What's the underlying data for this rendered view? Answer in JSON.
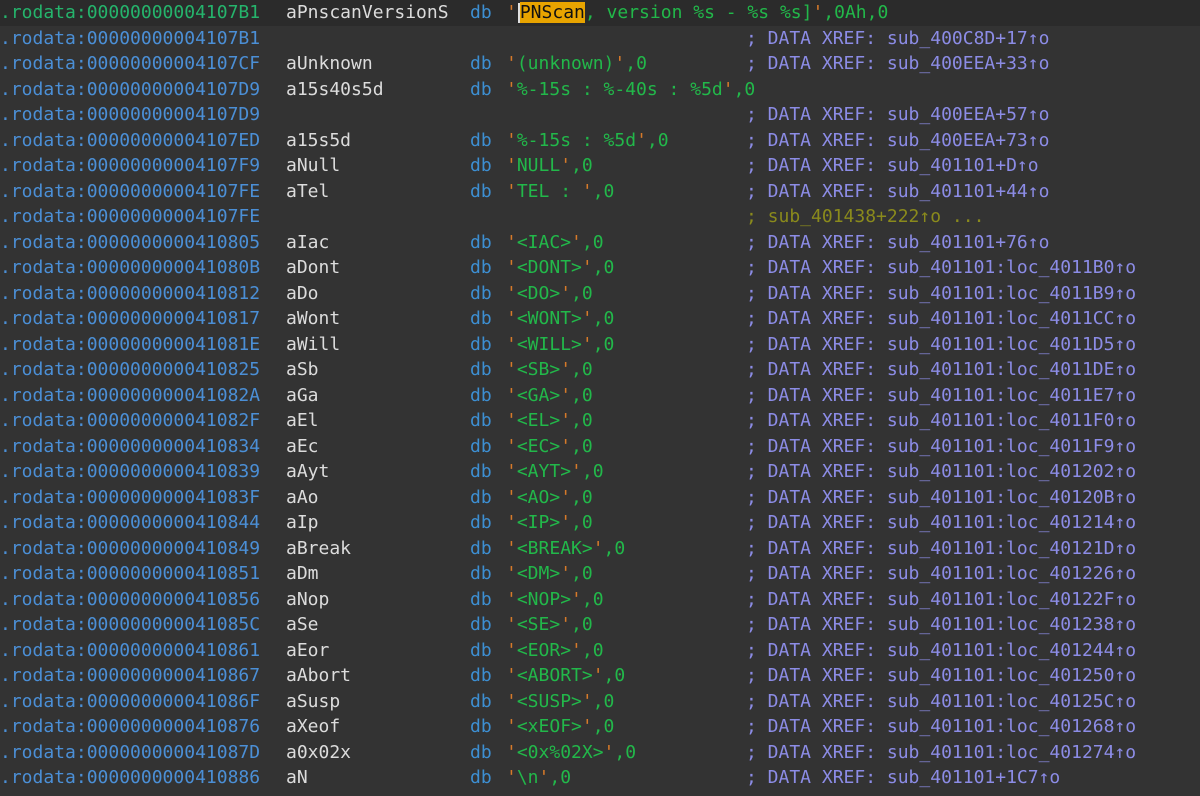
{
  "window": {
    "background": "#333333"
  },
  "rows": [
    {
      "addr": ".rodata:00000000004107B1",
      "label": "aPnscanVersionS",
      "dir": "db",
      "pre": "",
      "q1": "'",
      "cursor": true,
      "hl": "PNScan",
      "str": ", version %s - %s %s]",
      "q2": "'",
      "post": ",0Ah,0",
      "comment": "",
      "current": true
    },
    {
      "addr": ".rodata:00000000004107B1",
      "label": "",
      "dir": "",
      "pre": "",
      "q1": "",
      "hl": "",
      "str": "",
      "q2": "",
      "post": "",
      "comment": "; DATA XREF: sub_400C8D+17↑o"
    },
    {
      "addr": ".rodata:00000000004107CF",
      "label": "aUnknown",
      "dir": "db",
      "pre": "",
      "q1": "'",
      "hl": "",
      "str": "(unknown)",
      "q2": "'",
      "post": ",0",
      "comment": "; DATA XREF: sub_400EEA+33↑o"
    },
    {
      "addr": ".rodata:00000000004107D9",
      "label": "a15s40s5d",
      "dir": "db",
      "pre": "",
      "q1": "'",
      "hl": "",
      "str": "%-15s : %-40s : %5d",
      "q2": "'",
      "post": ",0",
      "comment": ""
    },
    {
      "addr": ".rodata:00000000004107D9",
      "label": "",
      "dir": "",
      "pre": "",
      "q1": "",
      "hl": "",
      "str": "",
      "q2": "",
      "post": "",
      "comment": "; DATA XREF: sub_400EEA+57↑o"
    },
    {
      "addr": ".rodata:00000000004107ED",
      "label": "a15s5d",
      "dir": "db",
      "pre": "",
      "q1": "'",
      "hl": "",
      "str": "%-15s : %5d",
      "q2": "'",
      "post": ",0",
      "comment": "; DATA XREF: sub_400EEA+73↑o"
    },
    {
      "addr": ".rodata:00000000004107F9",
      "label": "aNull",
      "dir": "db",
      "pre": "",
      "q1": "'",
      "hl": "",
      "str": "NULL",
      "q2": "'",
      "post": ",0",
      "comment": "; DATA XREF: sub_401101+D↑o"
    },
    {
      "addr": ".rodata:00000000004107FE",
      "label": "aTel",
      "dir": "db",
      "pre": "",
      "q1": "'",
      "hl": "",
      "str": "TEL : ",
      "q2": "'",
      "post": ",0",
      "comment": "; DATA XREF: sub_401101+44↑o"
    },
    {
      "addr": ".rodata:00000000004107FE",
      "label": "",
      "dir": "",
      "pre": "",
      "q1": "",
      "hl": "",
      "str": "",
      "q2": "",
      "post": "",
      "comment": "; sub_401438+222↑o ...",
      "olive": true
    },
    {
      "addr": ".rodata:0000000000410805",
      "label": "aIac",
      "dir": "db",
      "pre": "",
      "q1": "'",
      "hl": "",
      "str": "<IAC>",
      "q2": "'",
      "post": ",0",
      "comment": "; DATA XREF: sub_401101+76↑o"
    },
    {
      "addr": ".rodata:000000000041080B",
      "label": "aDont",
      "dir": "db",
      "pre": "",
      "q1": "'",
      "hl": "",
      "str": "<DONT>",
      "q2": "'",
      "post": ",0",
      "comment": "; DATA XREF: sub_401101:loc_4011B0↑o"
    },
    {
      "addr": ".rodata:0000000000410812",
      "label": "aDo",
      "dir": "db",
      "pre": "",
      "q1": "'",
      "hl": "",
      "str": "<DO>",
      "q2": "'",
      "post": ",0",
      "comment": "; DATA XREF: sub_401101:loc_4011B9↑o"
    },
    {
      "addr": ".rodata:0000000000410817",
      "label": "aWont",
      "dir": "db",
      "pre": "",
      "q1": "'",
      "hl": "",
      "str": "<WONT>",
      "q2": "'",
      "post": ",0",
      "comment": "; DATA XREF: sub_401101:loc_4011CC↑o"
    },
    {
      "addr": ".rodata:000000000041081E",
      "label": "aWill",
      "dir": "db",
      "pre": "",
      "q1": "'",
      "hl": "",
      "str": "<WILL>",
      "q2": "'",
      "post": ",0",
      "comment": "; DATA XREF: sub_401101:loc_4011D5↑o"
    },
    {
      "addr": ".rodata:0000000000410825",
      "label": "aSb",
      "dir": "db",
      "pre": "",
      "q1": "'",
      "hl": "",
      "str": "<SB>",
      "q2": "'",
      "post": ",0",
      "comment": "; DATA XREF: sub_401101:loc_4011DE↑o"
    },
    {
      "addr": ".rodata:000000000041082A",
      "label": "aGa",
      "dir": "db",
      "pre": "",
      "q1": "'",
      "hl": "",
      "str": "<GA>",
      "q2": "'",
      "post": ",0",
      "comment": "; DATA XREF: sub_401101:loc_4011E7↑o"
    },
    {
      "addr": ".rodata:000000000041082F",
      "label": "aEl",
      "dir": "db",
      "pre": "",
      "q1": "'",
      "hl": "",
      "str": "<EL>",
      "q2": "'",
      "post": ",0",
      "comment": "; DATA XREF: sub_401101:loc_4011F0↑o"
    },
    {
      "addr": ".rodata:0000000000410834",
      "label": "aEc",
      "dir": "db",
      "pre": "",
      "q1": "'",
      "hl": "",
      "str": "<EC>",
      "q2": "'",
      "post": ",0",
      "comment": "; DATA XREF: sub_401101:loc_4011F9↑o"
    },
    {
      "addr": ".rodata:0000000000410839",
      "label": "aAyt",
      "dir": "db",
      "pre": "",
      "q1": "'",
      "hl": "",
      "str": "<AYT>",
      "q2": "'",
      "post": ",0",
      "comment": "; DATA XREF: sub_401101:loc_401202↑o"
    },
    {
      "addr": ".rodata:000000000041083F",
      "label": "aAo",
      "dir": "db",
      "pre": "",
      "q1": "'",
      "hl": "",
      "str": "<AO>",
      "q2": "'",
      "post": ",0",
      "comment": "; DATA XREF: sub_401101:loc_40120B↑o"
    },
    {
      "addr": ".rodata:0000000000410844",
      "label": "aIp",
      "dir": "db",
      "pre": "",
      "q1": "'",
      "hl": "",
      "str": "<IP>",
      "q2": "'",
      "post": ",0",
      "comment": "; DATA XREF: sub_401101:loc_401214↑o"
    },
    {
      "addr": ".rodata:0000000000410849",
      "label": "aBreak",
      "dir": "db",
      "pre": "",
      "q1": "'",
      "hl": "",
      "str": "<BREAK>",
      "q2": "'",
      "post": ",0",
      "comment": "; DATA XREF: sub_401101:loc_40121D↑o"
    },
    {
      "addr": ".rodata:0000000000410851",
      "label": "aDm",
      "dir": "db",
      "pre": "",
      "q1": "'",
      "hl": "",
      "str": "<DM>",
      "q2": "'",
      "post": ",0",
      "comment": "; DATA XREF: sub_401101:loc_401226↑o"
    },
    {
      "addr": ".rodata:0000000000410856",
      "label": "aNop",
      "dir": "db",
      "pre": "",
      "q1": "'",
      "hl": "",
      "str": "<NOP>",
      "q2": "'",
      "post": ",0",
      "comment": "; DATA XREF: sub_401101:loc_40122F↑o"
    },
    {
      "addr": ".rodata:000000000041085C",
      "label": "aSe",
      "dir": "db",
      "pre": "",
      "q1": "'",
      "hl": "",
      "str": "<SE>",
      "q2": "'",
      "post": ",0",
      "comment": "; DATA XREF: sub_401101:loc_401238↑o"
    },
    {
      "addr": ".rodata:0000000000410861",
      "label": "aEor",
      "dir": "db",
      "pre": "",
      "q1": "'",
      "hl": "",
      "str": "<EOR>",
      "q2": "'",
      "post": ",0",
      "comment": "; DATA XREF: sub_401101:loc_401244↑o"
    },
    {
      "addr": ".rodata:0000000000410867",
      "label": "aAbort",
      "dir": "db",
      "pre": "",
      "q1": "'",
      "hl": "",
      "str": "<ABORT>",
      "q2": "'",
      "post": ",0",
      "comment": "; DATA XREF: sub_401101:loc_401250↑o"
    },
    {
      "addr": ".rodata:000000000041086F",
      "label": "aSusp",
      "dir": "db",
      "pre": "",
      "q1": "'",
      "hl": "",
      "str": "<SUSP>",
      "q2": "'",
      "post": ",0",
      "comment": "; DATA XREF: sub_401101:loc_40125C↑o"
    },
    {
      "addr": ".rodata:0000000000410876",
      "label": "aXeof",
      "dir": "db",
      "pre": "",
      "q1": "'",
      "hl": "",
      "str": "<xEOF>",
      "q2": "'",
      "post": ",0",
      "comment": "; DATA XREF: sub_401101:loc_401268↑o"
    },
    {
      "addr": ".rodata:000000000041087D",
      "label": "a0x02x",
      "dir": "db",
      "pre": "",
      "q1": "'",
      "hl": "",
      "str": "<0x%02X>",
      "q2": "'",
      "post": ",0",
      "comment": "; DATA XREF: sub_401101:loc_401274↑o"
    },
    {
      "addr": ".rodata:0000000000410886",
      "label": "aN",
      "dir": "db",
      "pre": "",
      "q1": "'",
      "hl": "",
      "str": "\\n",
      "q2": "'",
      "post": ",0",
      "comment": "; DATA XREF: sub_401101+1C7↑o"
    }
  ]
}
